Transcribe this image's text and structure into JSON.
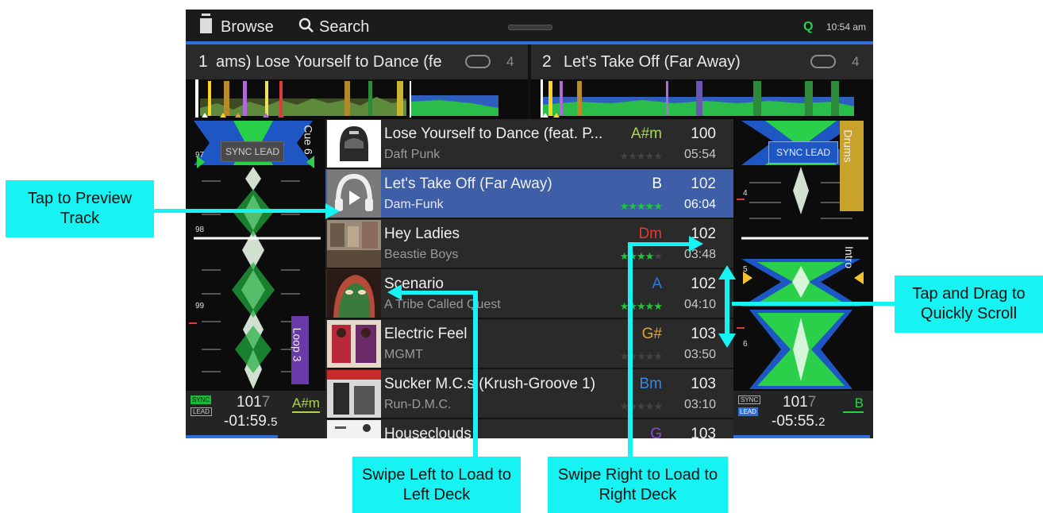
{
  "topbar": {
    "browse": "Browse",
    "search": "Search",
    "quantize": "Q",
    "clock": "10:54 am"
  },
  "decks": {
    "left": {
      "number": "1",
      "title": "ams)   Lose Yourself to Dance (fe",
      "loop_count": "4",
      "sync_lead": "SYNC LEAD",
      "cue_label": "Cue 6",
      "loop_label": "Loop 3",
      "beat_marks": [
        "97",
        "98",
        "99"
      ],
      "sync_badge": "SYNC",
      "lead_badge": "LEAD",
      "bpm_main": "101",
      "bpm_frac": "7",
      "key": "A#m",
      "remaining_main": "-01:59.",
      "remaining_frac": "5"
    },
    "right": {
      "number": "2",
      "title": "Let's Take Off (Far Away)",
      "loop_count": "4",
      "sync_lead": "SYNC LEAD",
      "drums_label": "Drums",
      "intro_label": "Intro",
      "beat_marks": [
        "4",
        "5",
        "6"
      ],
      "sync_badge": "SYNC",
      "lead_badge": "LEAD",
      "bpm_main": "101",
      "bpm_frac": "7",
      "key": "B",
      "remaining_main": "-05:55.",
      "remaining_frac": "2"
    }
  },
  "tracks": [
    {
      "title": "Lose Yourself to Dance (feat. P...",
      "artist": "Daft Punk",
      "key": "A#m",
      "key_color": "#a8d84a",
      "bpm": "100",
      "time": "05:54",
      "rating": 0
    },
    {
      "title": "Let's Take Off (Far Away)",
      "artist": "Dam-Funk",
      "key": "B",
      "key_color": "#ffffff",
      "bpm": "102",
      "time": "06:04",
      "rating": 5
    },
    {
      "title": "Hey Ladies",
      "artist": "Beastie Boys",
      "key": "Dm",
      "key_color": "#e23a3a",
      "bpm": "102",
      "time": "03:48",
      "rating": 4
    },
    {
      "title": "Scenario",
      "artist": "A Tribe Called Quest",
      "key": "A",
      "key_color": "#2c7ad8",
      "bpm": "102",
      "time": "04:10",
      "rating": 5
    },
    {
      "title": "Electric Feel",
      "artist": "MGMT",
      "key": "G#",
      "key_color": "#e6a22a",
      "bpm": "103",
      "time": "03:50",
      "rating": 0
    },
    {
      "title": "Sucker M.C.s (Krush-Groove 1)",
      "artist": "Run-D.M.C.",
      "key": "Bm",
      "key_color": "#3a86e8",
      "bpm": "103",
      "time": "03:10",
      "rating": 0
    },
    {
      "title": "Houseclouds",
      "artist": "",
      "key": "G",
      "key_color": "#8a4ad8",
      "bpm": "103",
      "time": "",
      "rating": 0
    }
  ],
  "callouts": {
    "preview": "Tap to Preview Track",
    "scroll": "Tap and Drag to Quickly Scroll",
    "swipe_left": "Swipe Left to Load to Left Deck",
    "swipe_right": "Swipe Right to Load to Right Deck"
  },
  "colors": {
    "accent_blue": "#2f6fd8",
    "selection": "#3e5ea8",
    "callout": "#17f2f2",
    "star_green": "#22c53a",
    "sync_green": "#1db93a"
  }
}
